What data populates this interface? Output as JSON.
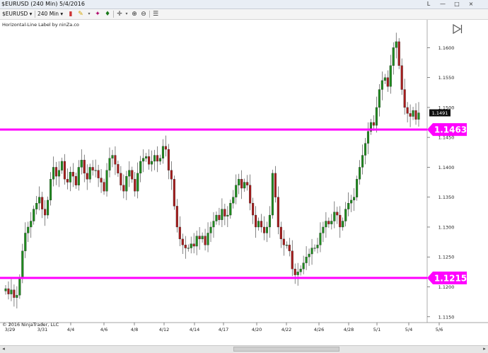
{
  "window": {
    "title": "$EURUSD (240 Min)  5/4/2016",
    "controls": [
      "L",
      "—",
      "□",
      "×"
    ]
  },
  "toolbar": {
    "instrument": "$EURUSD",
    "interval": "240 Min"
  },
  "indicator_label": "Horizontal-Line Label by ninZa.co",
  "copyright": "© 2016 NinjaTrader, LLC",
  "colors": {
    "up": "#1e8a1e",
    "down": "#a61c1c",
    "line": "#ff00ff",
    "label_bg": "#ff00ff",
    "label_text": "#ffffff"
  },
  "chart_data": {
    "type": "candlestick",
    "symbol": "$EURUSD",
    "interval": "240 Min",
    "ylim": [
      1.1145,
      1.163
    ],
    "y_ticks": [
      1.115,
      1.12,
      1.125,
      1.13,
      1.135,
      1.14,
      1.145,
      1.15,
      1.155,
      1.16
    ],
    "y_tick_labels": [
      "1.1150",
      "1.1200",
      "1.1250",
      "1.1300",
      "1.1350",
      "1.1400",
      "1.1450",
      "1.1500",
      "1.1550",
      "1.1600"
    ],
    "x_tick_labels": [
      "3/29",
      "3/31",
      "4/4",
      "4/6",
      "4/8",
      "4/12",
      "4/14",
      "4/17",
      "4/20",
      "4/22",
      "4/26",
      "4/28",
      "5/1",
      "5/4",
      "5/6"
    ],
    "current_price": "1.1491",
    "horizontal_lines": [
      {
        "value": 1.1463,
        "label": "1.1463"
      },
      {
        "value": 1.1215,
        "label": "1.1215"
      }
    ],
    "closes": [
      1.1197,
      1.1188,
      1.1195,
      1.1182,
      1.1186,
      1.1215,
      1.126,
      1.129,
      1.13,
      1.131,
      1.133,
      1.134,
      1.135,
      1.133,
      1.132,
      1.1345,
      1.138,
      1.14,
      1.1385,
      1.1395,
      1.141,
      1.138,
      1.1375,
      1.1392,
      1.1385,
      1.137,
      1.14,
      1.1412,
      1.139,
      1.138,
      1.14,
      1.1395,
      1.1395,
      1.1382,
      1.1375,
      1.136,
      1.1395,
      1.1415,
      1.142,
      1.1405,
      1.139,
      1.137,
      1.136,
      1.1385,
      1.1395,
      1.138,
      1.136,
      1.139,
      1.141,
      1.1415,
      1.1418,
      1.1405,
      1.141,
      1.142,
      1.141,
      1.1415,
      1.1435,
      1.143,
      1.1395,
      1.138,
      1.1335,
      1.13,
      1.128,
      1.127,
      1.1265,
      1.1265,
      1.1272,
      1.1268,
      1.1285,
      1.128,
      1.1285,
      1.127,
      1.129,
      1.13,
      1.131,
      1.132,
      1.1312,
      1.133,
      1.1318,
      1.132,
      1.134,
      1.135,
      1.137,
      1.138,
      1.1365,
      1.1375,
      1.137,
      1.134,
      1.132,
      1.13,
      1.131,
      1.13,
      1.129,
      1.13,
      1.132,
      1.139,
      1.135,
      1.13,
      1.128,
      1.127,
      1.127,
      1.126,
      1.123,
      1.122,
      1.1225,
      1.123,
      1.124,
      1.125,
      1.1255,
      1.1265,
      1.1265,
      1.127,
      1.129,
      1.13,
      1.131,
      1.1305,
      1.131,
      1.1325,
      1.132,
      1.13,
      1.131,
      1.133,
      1.134,
      1.1345,
      1.135,
      1.138,
      1.14,
      1.142,
      1.144,
      1.146,
      1.1475,
      1.147,
      1.15,
      1.153,
      1.1545,
      1.155,
      1.1535,
      1.157,
      1.16,
      1.161,
      1.157,
      1.153,
      1.15,
      1.149,
      1.1485,
      1.1495,
      1.148,
      1.1491
    ]
  }
}
